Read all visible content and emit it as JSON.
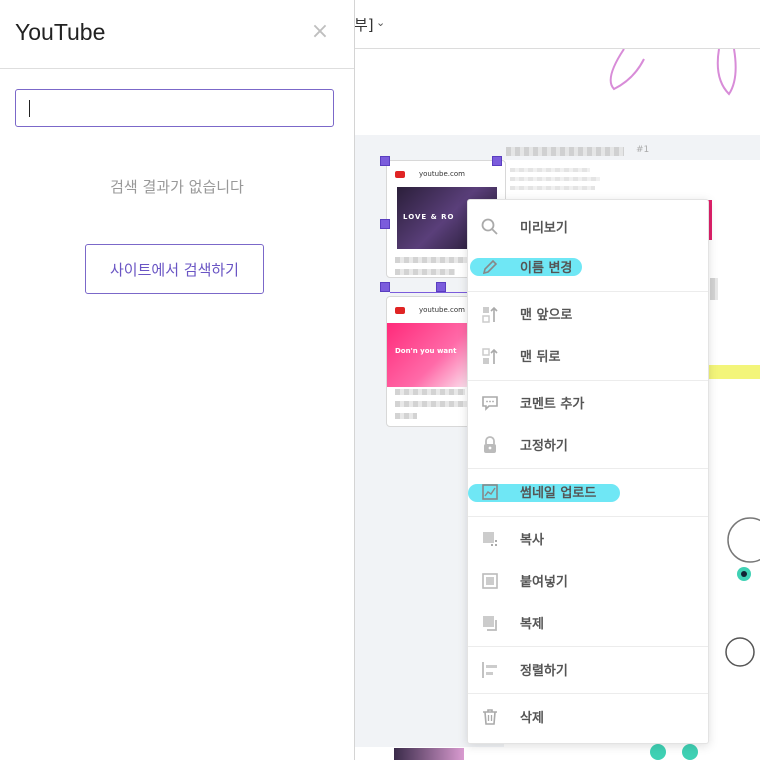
{
  "panel": {
    "title": "YouTube",
    "close_glyph": "×",
    "search_placeholder": "",
    "empty_message": "검색 결과가 없습니다",
    "site_search_label": "사이트에서 검색하기"
  },
  "canvas": {
    "topbar_text": "부]",
    "topbar_chevron": "⌄",
    "page_marker": "#1",
    "cards": [
      {
        "domain": "youtube.com",
        "thumb_text": "LOVE & RO"
      },
      {
        "domain": "youtube.com",
        "thumb_text": "Don'n you want"
      }
    ]
  },
  "context_menu": {
    "items": [
      {
        "label": "미리보기",
        "icon": "search-icon"
      },
      {
        "label": "이름 변경",
        "icon": "pencil-icon",
        "highlighted": true
      },
      {
        "label": "맨 앞으로",
        "icon": "bring-front-icon"
      },
      {
        "label": "맨 뒤로",
        "icon": "send-back-icon"
      },
      {
        "label": "코멘트 추가",
        "icon": "comment-icon"
      },
      {
        "label": "고정하기",
        "icon": "lock-icon"
      },
      {
        "label": "썸네일 업로드",
        "icon": "image-icon",
        "highlighted": true
      },
      {
        "label": "복사",
        "icon": "copy-icon"
      },
      {
        "label": "붙여넣기",
        "icon": "paste-icon"
      },
      {
        "label": "복제",
        "icon": "duplicate-icon"
      },
      {
        "label": "정렬하기",
        "icon": "align-icon"
      },
      {
        "label": "삭제",
        "icon": "trash-icon"
      }
    ]
  },
  "colors": {
    "accent": "#7b68c9",
    "handle": "#7b5cdc",
    "highlight": "#5fe4f4",
    "menu_text": "#555555"
  }
}
